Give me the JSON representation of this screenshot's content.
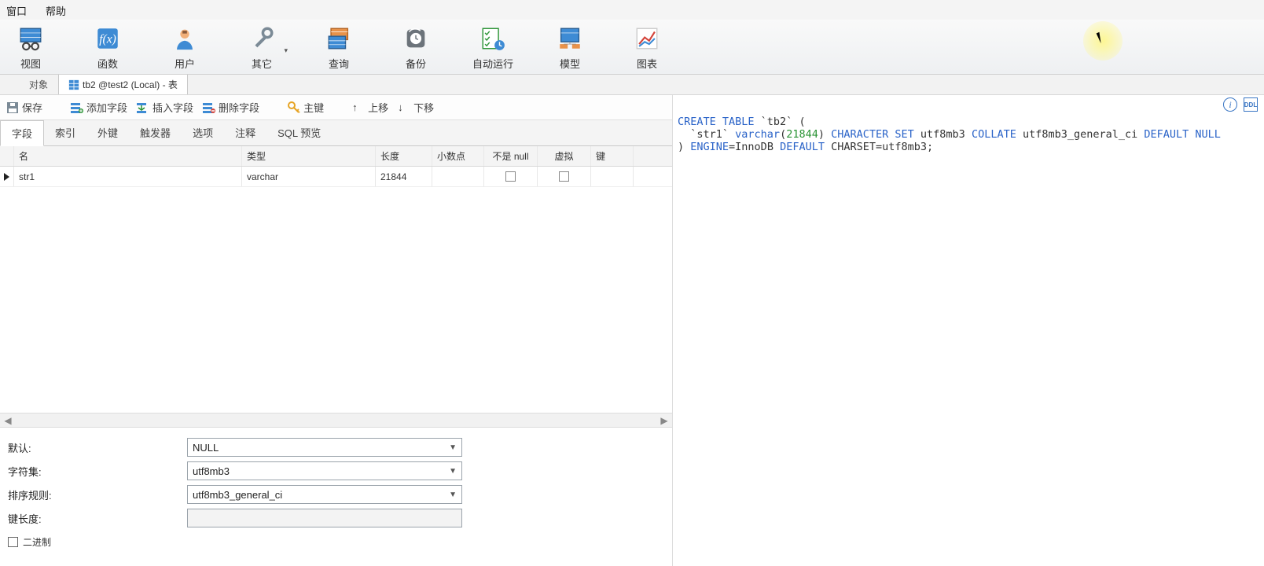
{
  "menu": {
    "window": "窗口",
    "help": "帮助"
  },
  "ribbon": [
    {
      "id": "view",
      "label": "视图"
    },
    {
      "id": "func",
      "label": "函数"
    },
    {
      "id": "user",
      "label": "用户"
    },
    {
      "id": "other",
      "label": "其它",
      "caret": true
    },
    {
      "id": "query",
      "label": "查询"
    },
    {
      "id": "backup",
      "label": "备份"
    },
    {
      "id": "auto",
      "label": "自动运行"
    },
    {
      "id": "model",
      "label": "模型"
    },
    {
      "id": "chart",
      "label": "图表"
    }
  ],
  "docTabs": {
    "objects": "对象",
    "active": "tb2 @test2 (Local) - 表"
  },
  "toolbar": {
    "save": "保存",
    "addField": "添加字段",
    "insertField": "插入字段",
    "deleteField": "删除字段",
    "primaryKey": "主键",
    "moveUp": "上移",
    "moveDown": "下移"
  },
  "subTabs": [
    "字段",
    "索引",
    "外键",
    "触发器",
    "选项",
    "注释",
    "SQL 预览"
  ],
  "columns": {
    "name": "名",
    "type": "类型",
    "len": "长度",
    "dec": "小数点",
    "notnull": "不是 null",
    "virt": "虚拟",
    "key": "键"
  },
  "rows": [
    {
      "name": "str1",
      "type": "varchar",
      "len": "21844",
      "dec": "",
      "notnull": false,
      "virt": false
    }
  ],
  "props": {
    "default_label": "默认:",
    "default_value": "NULL",
    "charset_label": "字符集:",
    "charset_value": "utf8mb3",
    "collate_label": "排序规则:",
    "collate_value": "utf8mb3_general_ci",
    "keylen_label": "键长度:",
    "binary_label": "二进制"
  },
  "sql": {
    "l1_a": "CREATE TABLE",
    "l1_b": " `tb2` (",
    "l2_a": "  `str1` ",
    "l2_b": "varchar",
    "l2_c": "(",
    "l2_d": "21844",
    "l2_e": ") ",
    "l2_f": "CHARACTER SET",
    "l2_g": " utf8mb3 ",
    "l2_h": "COLLATE",
    "l2_i": " utf8mb3_general_ci ",
    "l2_j": "DEFAULT NULL",
    "l3_a": ") ",
    "l3_b": "ENGINE",
    "l3_c": "=InnoDB ",
    "l3_d": "DEFAULT",
    "l3_e": " CHARSET=utf8mb3;"
  }
}
